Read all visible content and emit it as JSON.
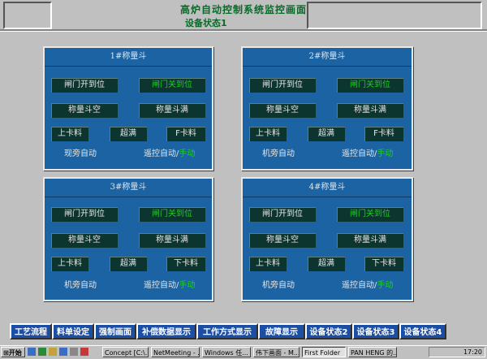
{
  "header": {
    "title": "高炉自动控制系统监控画面",
    "subtitle": "设备状态1"
  },
  "panels": [
    {
      "title": "1#称量斗",
      "gate_open": "闸门开到位",
      "gate_close": "闸门关到位",
      "empty": "称量斗空",
      "full": "称量斗满",
      "upper_jam": "上卡料",
      "overfull": "超满",
      "lower_jam": "F卡料",
      "local_auto": "现旁自动",
      "remote_auto": "遥控自动/",
      "manual": "手动"
    },
    {
      "title": "2#称量斗",
      "gate_open": "闸门开到位",
      "gate_close": "闸门关到位",
      "empty": "称量斗空",
      "full": "称量斗满",
      "upper_jam": "上卡料",
      "overfull": "超满",
      "lower_jam": "F卡料",
      "local_auto": "机旁自动",
      "remote_auto": "遥控自动/",
      "manual": "手动"
    },
    {
      "title": "3#称量斗",
      "gate_open": "闸门开到位",
      "gate_close": "闸门关到位",
      "empty": "称量斗空",
      "full": "称量斗满",
      "upper_jam": "上卡料",
      "overfull": "超满",
      "lower_jam": "下卡料",
      "local_auto": "机旁自动",
      "remote_auto": "遥控自动/",
      "manual": "手动"
    },
    {
      "title": "4#称量斗",
      "gate_open": "闸门开到位",
      "gate_close": "闸门关到位",
      "empty": "称量斗空",
      "full": "称量斗满",
      "upper_jam": "上卡料",
      "overfull": "超满",
      "lower_jam": "下卡料",
      "local_auto": "机旁自动",
      "remote_auto": "遥控自动/",
      "manual": "手动"
    }
  ],
  "menu": [
    "工艺流程",
    "料单设定",
    "强制画面",
    "补偿数据显示",
    "工作方式显示",
    "故障显示",
    "设备状态2",
    "设备状态3",
    "设备状态4"
  ],
  "taskbar": {
    "start": "开始",
    "items": [
      "Concept [C:\\...",
      "NetMeeting - ...",
      "Windows 任...",
      "伟下画面 - M...",
      "First Folder",
      "PAN HENG 的..."
    ],
    "clock": "17:20"
  },
  "colors": {
    "panel_bg": "#1c63a3",
    "cell_bg": "#0c3530",
    "status_green": "#1bd11b",
    "title_green": "#0a6a2a",
    "menu_button": "#1c4ea3"
  }
}
